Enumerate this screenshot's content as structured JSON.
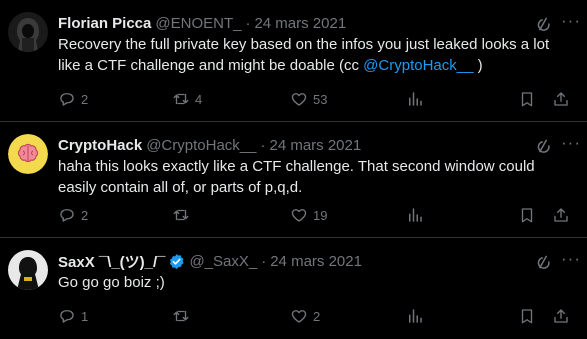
{
  "tweets": [
    {
      "author": "Florian Picca",
      "handle": "@ENOENT_",
      "separator": "·",
      "date": "24 mars 2021",
      "text_before": "Recovery the full private key based on the infos you just leaked looks a lot like a CTF challenge and might be doable (cc ",
      "mention": "@CryptoHack__",
      "text_after": " )",
      "replies": "2",
      "retweets": "4",
      "likes": "53",
      "avatar_icon": "dark-hooded-figure"
    },
    {
      "author": "CryptoHack",
      "handle": "@CryptoHack__",
      "separator": "·",
      "date": "24 mars 2021",
      "text": "haha this looks exactly like a CTF challenge. That second window could easily contain all of, or parts of p,q,d.",
      "replies": "2",
      "retweets": "",
      "likes": "19",
      "avatar_icon": "brain-emoji",
      "avatar_color": "#f2d94e"
    },
    {
      "author": "SaxX ¯\\_(ツ)_/¯",
      "handle": "@_SaxX_",
      "separator": "·",
      "date": "24 mars 2021",
      "text": "Go go go boiz ;)",
      "replies": "1",
      "retweets": "",
      "likes": "2",
      "verified": true,
      "verified_color": "#1d9bf0",
      "avatar_icon": "hooded-figure-photo"
    }
  ],
  "icons": {
    "reply": "reply-icon",
    "retweet": "retweet-icon",
    "like": "heart-icon",
    "views": "views-icon",
    "bookmark": "bookmark-icon",
    "share": "share-icon",
    "grok": "grok-icon",
    "more": "more-icon"
  },
  "colors": {
    "background": "#000000",
    "text": "#e7e9ea",
    "muted": "#71767b",
    "link": "#1d9bf0",
    "divider": "#2f3336"
  }
}
